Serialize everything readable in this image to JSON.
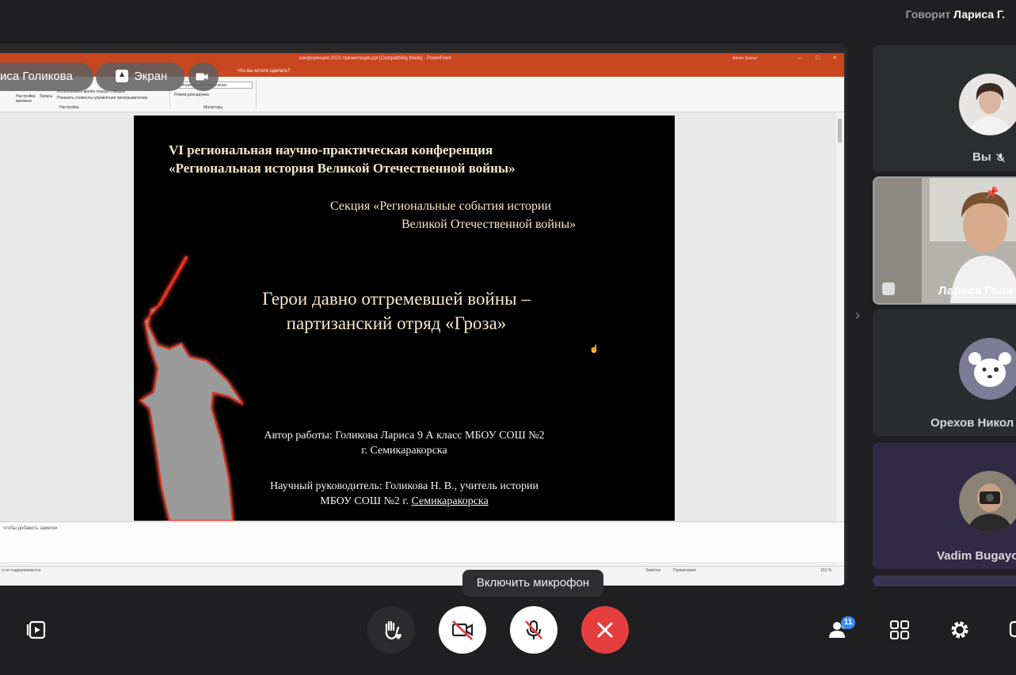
{
  "header": {
    "speaking_prefix": "Говорит",
    "speaker_name": "Лариса Г."
  },
  "shared_screen": {
    "chip_name": "иса Голикова",
    "chip_screen_label": "Экран",
    "powerpoint": {
      "title": "конференция 2023 презентация.ppt [Compatibility Mode] - PowerPoint",
      "user": "Admin School",
      "search_hint": "Что вы хотите сделать?",
      "ribbon": {
        "monitor_label": "Монитор: Автоматически",
        "presenter_mode": "Режим докладчика",
        "monitors_group": "Мониторы",
        "setup_group": "Настройка",
        "setup_time": "Настройка времени",
        "record": "Запись",
        "use_timings": "Использовать время показа слайдов",
        "show_media": "Показать элементы управления проигрывателем"
      },
      "notes_placeholder": "чтобы добавить заметки",
      "status_left": "и не поддерживается",
      "status_notes": "Заметки",
      "status_comments": "Примечания",
      "zoom": "153 %"
    },
    "slide": {
      "conf_line1": "VI региональная научно-практическая конференция",
      "conf_line2": "«Региональная история Великой Отечественной войны»",
      "section_line1": "Секция «Региональные события истории",
      "section_line2": "Великой Отечественной войны»",
      "topic_line1": "Герои давно отгремевшей войны –",
      "topic_line2": "партизанский отряд «Гроза»",
      "author_line1": "Автор работы: Голикова Лариса 9 А класс МБОУ СОШ №2",
      "author_line2": "г. Семикаракорска",
      "advisor_line1": "Научный руководитель: Голикова Н. В., учитель истории",
      "advisor_line2_prefix": "МБОУ СОШ №2 г. ",
      "advisor_line2_city": "Семикаракорска"
    }
  },
  "participants": [
    {
      "name": "Вы",
      "muted": true
    },
    {
      "name": "Лариса Голи",
      "pinned": true,
      "sharing": true
    },
    {
      "name": "Орехов Никол"
    },
    {
      "name": "Vadim Bugayo"
    }
  ],
  "tooltip": "Включить микрофон",
  "toolbar": {
    "participants_count": "11"
  },
  "colors": {
    "end_call": "#e63e3e",
    "badge": "#3a8cf0",
    "ppt_accent": "#c8471f"
  }
}
